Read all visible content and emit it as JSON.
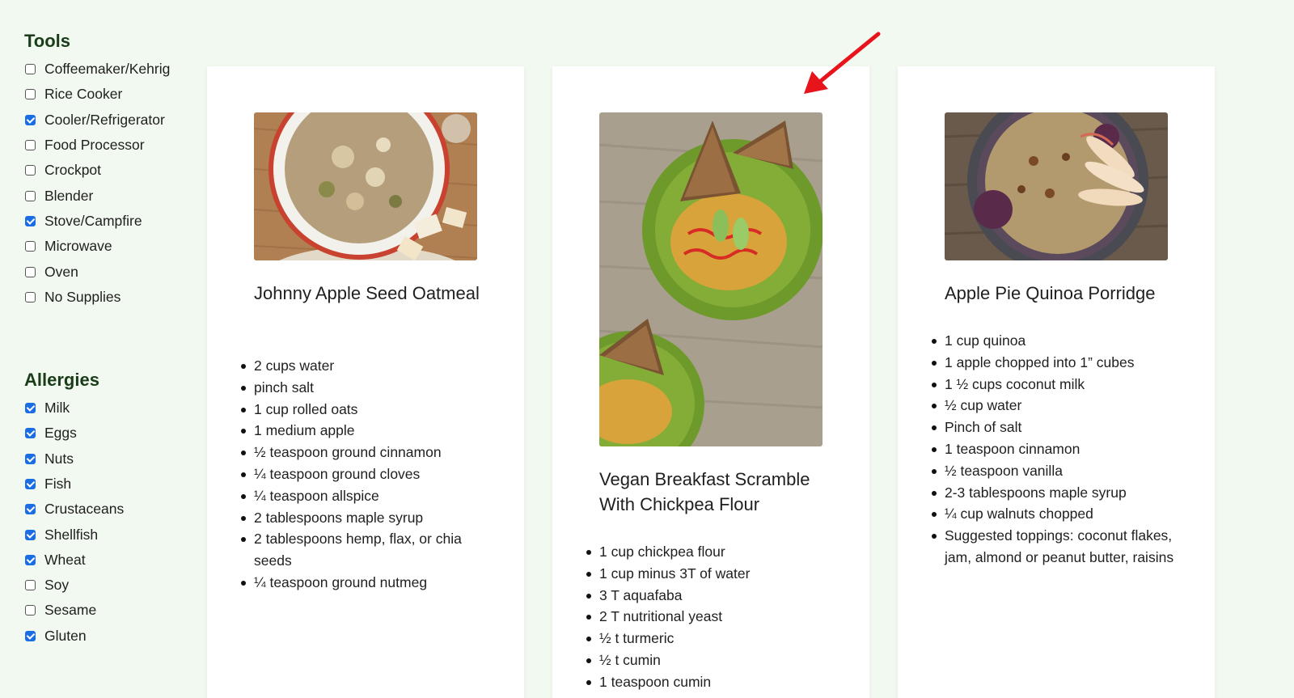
{
  "filters": {
    "tools": {
      "title": "Tools",
      "items": [
        {
          "label": "Coffeemaker/Kehrig",
          "checked": false
        },
        {
          "label": "Rice Cooker",
          "checked": false
        },
        {
          "label": "Cooler/Refrigerator",
          "checked": true
        },
        {
          "label": "Food Processor",
          "checked": false
        },
        {
          "label": "Crockpot",
          "checked": false
        },
        {
          "label": "Blender",
          "checked": false
        },
        {
          "label": "Stove/Campfire",
          "checked": true
        },
        {
          "label": "Microwave",
          "checked": false
        },
        {
          "label": "Oven",
          "checked": false
        },
        {
          "label": "No Supplies",
          "checked": false
        }
      ]
    },
    "allergies": {
      "title": "Allergies",
      "items": [
        {
          "label": "Milk",
          "checked": true
        },
        {
          "label": "Eggs",
          "checked": true
        },
        {
          "label": "Nuts",
          "checked": true
        },
        {
          "label": "Fish",
          "checked": true
        },
        {
          "label": "Crustaceans",
          "checked": true
        },
        {
          "label": "Shellfish",
          "checked": true
        },
        {
          "label": "Wheat",
          "checked": true
        },
        {
          "label": "Soy",
          "checked": false
        },
        {
          "label": "Sesame",
          "checked": false
        },
        {
          "label": "Gluten",
          "checked": true
        }
      ]
    }
  },
  "recipes": [
    {
      "title": "Johnny Apple Seed Oatmeal",
      "image": "oatmeal-bowl-photo",
      "ingredients": [
        "2 cups water",
        "pinch salt",
        "1 cup rolled oats",
        "1 medium apple",
        "½ teaspoon ground cinnamon",
        "¼ teaspoon ground cloves",
        "¼ teaspoon allspice",
        "2 tablespoons maple syrup",
        "2 tablespoons hemp, flax, or chia seeds",
        "¼ teaspoon ground nutmeg"
      ]
    },
    {
      "title": "Vegan Breakfast Scramble With Chickpea Flour",
      "image": "chickpea-scramble-photo",
      "ingredients": [
        "1 cup chickpea flour",
        "1 cup minus 3T of water",
        "3 T aquafaba",
        "2 T nutritional yeast",
        "½ t turmeric",
        "½ t cumin",
        "1 teaspoon cumin"
      ]
    },
    {
      "title": "Apple Pie Quinoa Porridge",
      "image": "quinoa-porridge-photo",
      "ingredients": [
        "1 cup quinoa",
        "1 apple chopped into 1” cubes",
        "1 ½ cups coconut milk",
        "½ cup water",
        "Pinch of salt",
        "1 teaspoon cinnamon",
        "½ teaspoon vanilla",
        "2-3 tablespoons maple syrup",
        "¼ cup walnuts chopped",
        "Suggested toppings: coconut flakes, jam, almond or peanut butter, raisins"
      ]
    }
  ],
  "colors": {
    "page_bg": "#f2f9f0",
    "heading": "#183d18",
    "checkbox_checked": "#1a6de3",
    "annotation_arrow": "#e8141c"
  }
}
